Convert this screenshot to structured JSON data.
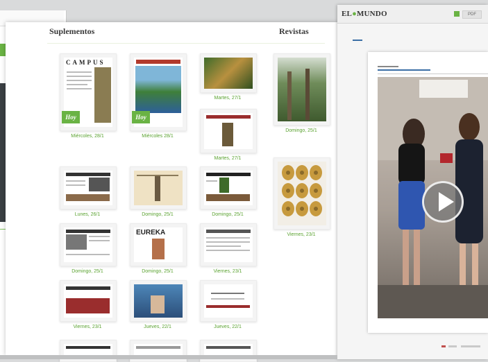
{
  "main": {
    "section_supplements": "Suplementos",
    "section_magazines": "Revistas",
    "badge": "Hoy",
    "supplements": [
      {
        "masthead": "CAMPUS",
        "caption": "Miércoles, 28/1"
      },
      {
        "masthead": "",
        "caption": "Miércoles 28/1"
      },
      {
        "masthead": "",
        "caption": "Martes, 27/1"
      },
      {
        "masthead": "",
        "caption": "Martes, 27/1"
      },
      {
        "masthead": "",
        "caption": "Lunes, 26/1"
      },
      {
        "masthead": "",
        "caption": "Domingo, 25/1"
      },
      {
        "masthead": "",
        "caption": "Domingo, 25/1"
      },
      {
        "masthead": "",
        "caption": "Domingo, 25/1"
      },
      {
        "masthead": "EUREKA",
        "caption": "Domingo, 25/1"
      },
      {
        "masthead": "",
        "caption": "Viernes, 23/1"
      },
      {
        "masthead": "",
        "caption": "Viernes, 23/1"
      },
      {
        "masthead": "",
        "caption": "Jueves, 22/1"
      },
      {
        "masthead": "",
        "caption": "Jueves, 22/1"
      }
    ],
    "magazines": [
      {
        "caption": "Domingo, 25/1"
      },
      {
        "caption": "Viernes, 23/1"
      }
    ]
  },
  "viewer": {
    "logo_left": "EL",
    "logo_right": "MUNDO",
    "toolbar_label": "PDF"
  },
  "colors": {
    "accent_green": "#6ab344",
    "link_blue": "#3a6ea5"
  }
}
